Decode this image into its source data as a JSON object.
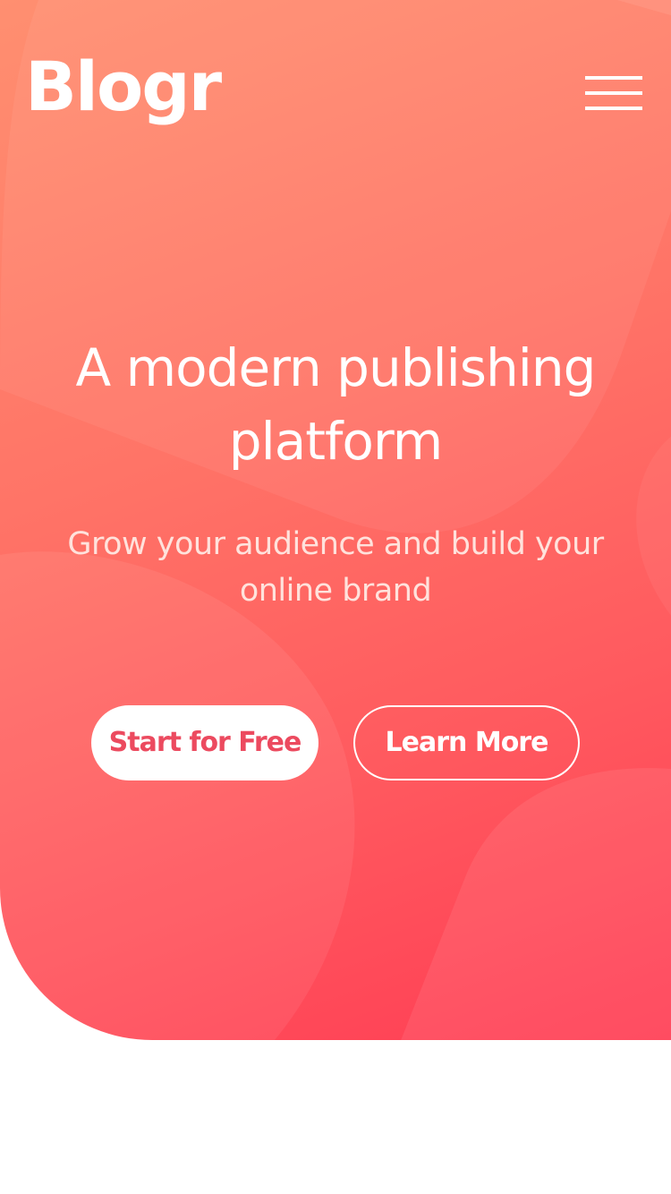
{
  "header": {
    "logo_text": "Blogr",
    "menu_icon": "hamburger-menu-icon"
  },
  "hero": {
    "headline": "A modern publishing platform",
    "subheadline": "Grow your audience and build your online brand",
    "primary_button_label": "Start for Free",
    "secondary_button_label": "Learn More"
  },
  "colors": {
    "gradient_start": "#ff8f70",
    "gradient_end": "#ff3d54",
    "primary_button_text": "#ec4a5f",
    "text_light": "#ffffff"
  }
}
